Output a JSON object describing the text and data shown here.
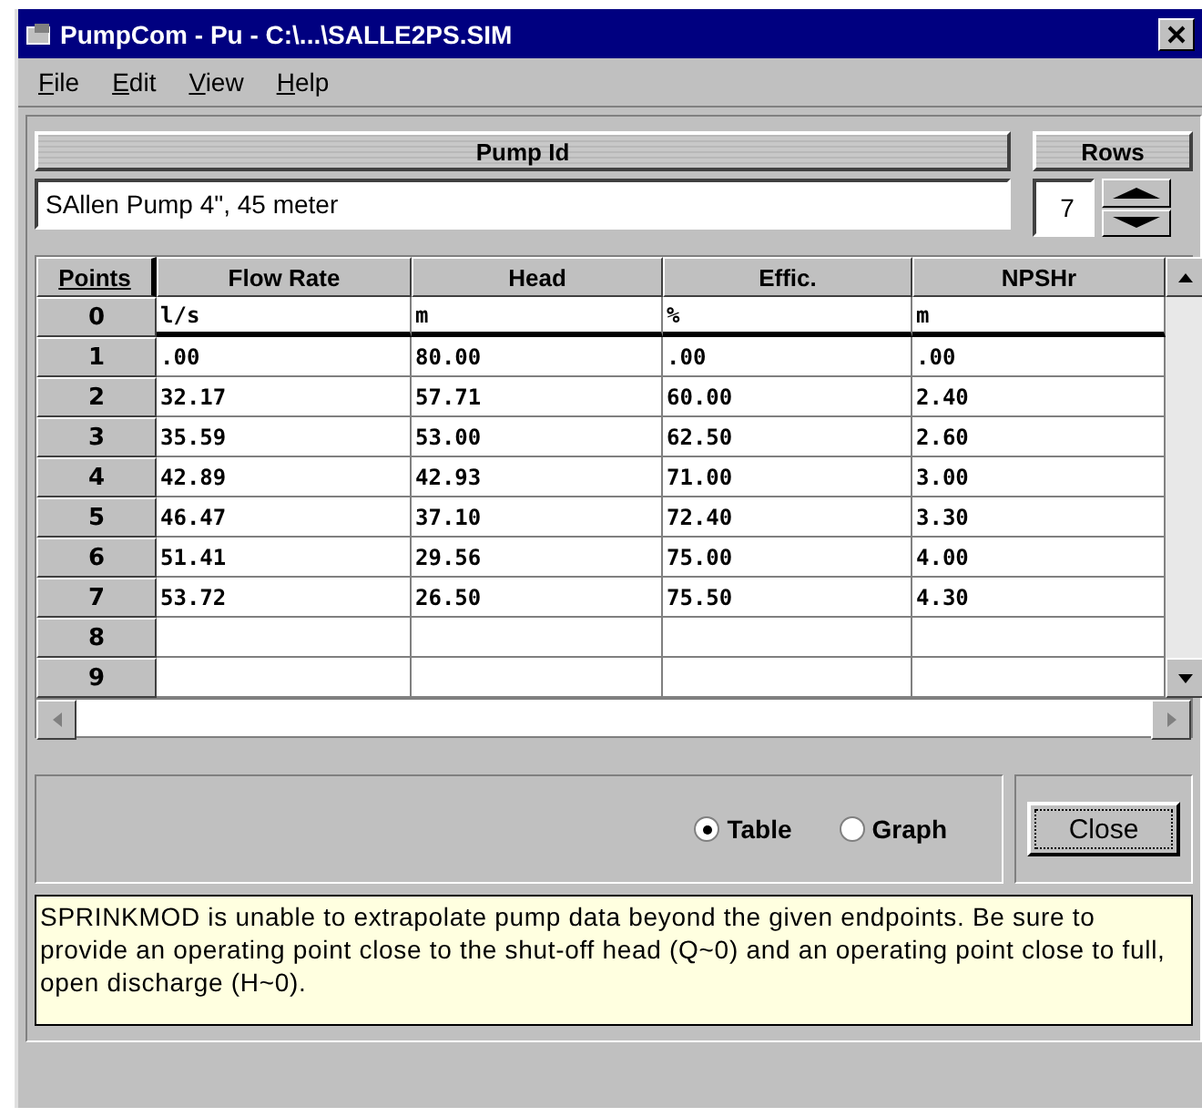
{
  "window": {
    "title": "PumpCom - Pu - C:\\...\\SALLE2PS.SIM"
  },
  "menu": [
    "File",
    "Edit",
    "View",
    "Help"
  ],
  "pump_id": {
    "label": "Pump Id",
    "value": "SAllen Pump 4\", 45 meter"
  },
  "rows_control": {
    "label": "Rows",
    "value": "7"
  },
  "table": {
    "columns": [
      "Points",
      "Flow Rate",
      "Head",
      "Effic.",
      "NPSHr"
    ],
    "rows": [
      [
        "0",
        "l/s",
        "m",
        "%",
        "m"
      ],
      [
        "1",
        ".00",
        "80.00",
        ".00",
        ".00"
      ],
      [
        "2",
        "32.17",
        "57.71",
        "60.00",
        "2.40"
      ],
      [
        "3",
        "35.59",
        "53.00",
        "62.50",
        "2.60"
      ],
      [
        "4",
        "42.89",
        "42.93",
        "71.00",
        "3.00"
      ],
      [
        "5",
        "46.47",
        "37.10",
        "72.40",
        "3.30"
      ],
      [
        "6",
        "51.41",
        "29.56",
        "75.00",
        "4.00"
      ],
      [
        "7",
        "53.72",
        "26.50",
        "75.50",
        "4.30"
      ],
      [
        "8",
        "",
        "",
        "",
        ""
      ],
      [
        "9",
        "",
        "",
        "",
        ""
      ]
    ]
  },
  "view_options": [
    {
      "label": "Table",
      "selected": true
    },
    {
      "label": "Graph",
      "selected": false
    }
  ],
  "close_button": "Close",
  "message": "SPRINKMOD is unable to extrapolate pump data beyond the given endpoints. Be sure to provide an operating point close to the shut-off head (Q~0) and an operating point close to full, open discharge (H~0)."
}
